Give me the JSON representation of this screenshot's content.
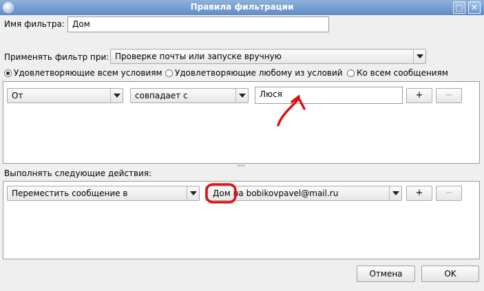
{
  "window": {
    "title": "Правила фильтрации"
  },
  "filter_name": {
    "label": "Имя фильтра:",
    "value": "Дом"
  },
  "apply": {
    "label": "Применять фильтр при:",
    "selected": "Проверке почты или запуске вручную"
  },
  "match": {
    "options": [
      {
        "label": "Удовлетворяющие всем условиям",
        "selected": true
      },
      {
        "label": "Удовлетворяющие любому из условий",
        "selected": false
      },
      {
        "label": "Ко всем сообщениям",
        "selected": false
      }
    ]
  },
  "condition": {
    "field": "От",
    "operator": "совпадает с",
    "value": "Люся",
    "add_label": "+",
    "remove_label": "−"
  },
  "actions": {
    "label": "Выполнять следующие действия:",
    "action": "Переместить сообщение в",
    "target": "Дом на bobikovpavel@mail.ru",
    "add_label": "+",
    "remove_label": "−"
  },
  "buttons": {
    "cancel": "Отмена",
    "ok": "OK"
  },
  "colors": {
    "annotation": "#e01010",
    "titlebar": "#6f97cc"
  }
}
